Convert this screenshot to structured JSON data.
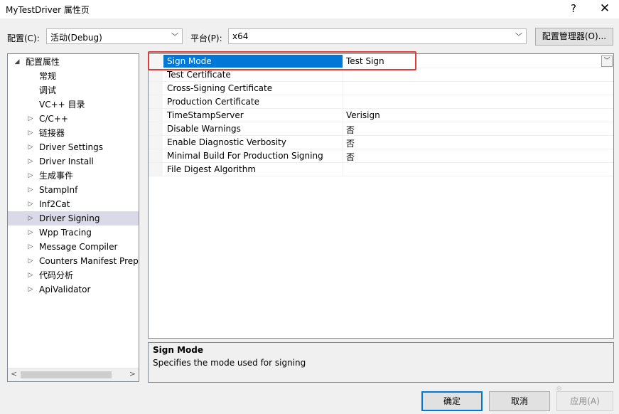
{
  "window": {
    "title": "MyTestDriver 属性页",
    "help_glyph": "?",
    "close_glyph": "✕"
  },
  "toolbar": {
    "config_label": "配置(C):",
    "config_value": "活动(Debug)",
    "platform_label": "平台(P):",
    "platform_value": "x64",
    "config_manager_label": "配置管理器(O)..."
  },
  "tree": {
    "items": [
      {
        "label": "配置属性",
        "expander": "◢"
      },
      {
        "label": "常规",
        "expander": ""
      },
      {
        "label": "调试",
        "expander": ""
      },
      {
        "label": "VC++ 目录",
        "expander": ""
      },
      {
        "label": "C/C++",
        "expander": "▷"
      },
      {
        "label": "链接器",
        "expander": "▷"
      },
      {
        "label": "Driver Settings",
        "expander": "▷"
      },
      {
        "label": "Driver Install",
        "expander": "▷"
      },
      {
        "label": "生成事件",
        "expander": "▷"
      },
      {
        "label": "StampInf",
        "expander": "▷"
      },
      {
        "label": "Inf2Cat",
        "expander": "▷"
      },
      {
        "label": "Driver Signing",
        "expander": "▷"
      },
      {
        "label": "Wpp Tracing",
        "expander": "▷"
      },
      {
        "label": "Message Compiler",
        "expander": "▷"
      },
      {
        "label": "Counters Manifest Preprocessor",
        "expander": "▷"
      },
      {
        "label": "代码分析",
        "expander": "▷"
      },
      {
        "label": "ApiValidator",
        "expander": "▷"
      }
    ],
    "selected_index": 11
  },
  "properties": [
    {
      "name": "Sign Mode",
      "value": "Test Sign"
    },
    {
      "name": "Test Certificate",
      "value": ""
    },
    {
      "name": "Cross-Signing Certificate",
      "value": ""
    },
    {
      "name": "Production Certificate",
      "value": ""
    },
    {
      "name": "TimeStampServer",
      "value": "Verisign"
    },
    {
      "name": "Disable Warnings",
      "value": "否"
    },
    {
      "name": "Enable Diagnostic Verbosity",
      "value": "否"
    },
    {
      "name": "Minimal Build For Production Signing",
      "value": "否"
    },
    {
      "name": "File Digest Algorithm",
      "value": ""
    }
  ],
  "description": {
    "title": "Sign Mode",
    "text": "Specifies the mode used for signing"
  },
  "buttons": {
    "ok": "确定",
    "cancel": "取消",
    "apply": "应用(A)"
  },
  "colors": {
    "selection_blue": "#0078d7",
    "highlight_red": "#e03a3a",
    "tree_selection": "#d9d9e8"
  }
}
